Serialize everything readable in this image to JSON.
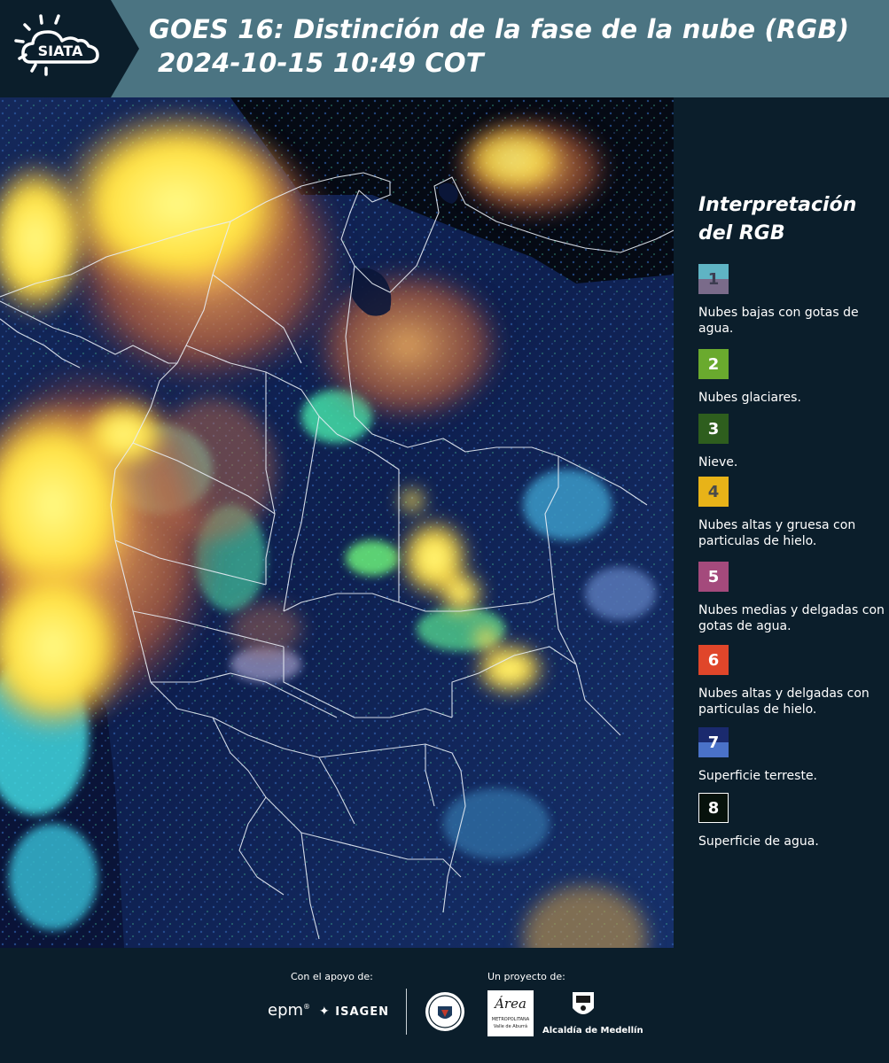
{
  "header": {
    "logo_text": "SIATA",
    "title_line_1": "GOES 16: Distinción de la fase de la nube (RGB)",
    "title_line_2": "2024-10-15 10:49 COT"
  },
  "legend": {
    "title": "Interpretación del RGB",
    "items": [
      {
        "number": "1",
        "label": "Nubes bajas con gotas de agua.",
        "color_top": "#5fb4c4",
        "color_bottom": "#7a6b8a",
        "number_color": "#3c3c50"
      },
      {
        "number": "2",
        "label": "Nubes glaciares.",
        "color_top": "#6aaa2e",
        "color_bottom": "#6aaa2e",
        "number_color": "#ffffff"
      },
      {
        "number": "3",
        "label": "Nieve.",
        "color_top": "#2e5e1e",
        "color_bottom": "#2e5e1e",
        "number_color": "#ffffff"
      },
      {
        "number": "4",
        "label": "Nubes altas y gruesa con particulas de hielo.",
        "color_top": "#e8b318",
        "color_bottom": "#e8b318",
        "number_color": "#4a4a4a"
      },
      {
        "number": "5",
        "label": "Nubes medias y delgadas con gotas de agua.",
        "color_top": "#a44a7c",
        "color_bottom": "#a44a7c",
        "number_color": "#ffffff"
      },
      {
        "number": "6",
        "label": "Nubes altas y delgadas con particulas de hielo.",
        "color_top": "#e0462a",
        "color_bottom": "#e0462a",
        "number_color": "#ffffff"
      },
      {
        "number": "7",
        "label": "Superficie terreste.",
        "color_top": "#1a2a6e",
        "color_bottom": "#4a72c8",
        "number_color": "#ffffff"
      },
      {
        "number": "8",
        "label": "Superficie de agua.",
        "color_top": "#07120c",
        "color_bottom": "#07120c",
        "number_color": "#ffffff"
      }
    ]
  },
  "footer": {
    "support_caption": "Con el apoyo de:",
    "project_caption": "Un proyecto de:",
    "sponsor_epm": "epm",
    "sponsor_isagen": "ISAGEN",
    "partner_area_name": "Área",
    "partner_area_sub": "METROPOLITANA",
    "partner_area_sub2": "Valle de Aburrá",
    "partner_alcaldia": "Alcaldía de Medellín"
  },
  "colors": {
    "background": "#0b1e2b",
    "banner": "#4b7482",
    "map_surface": "#0d1a3e",
    "cloud_high_thick": "#ffee55",
    "cloud_high_thin": "#e07a3a",
    "cloud_ice": "#8aff7a",
    "cloud_low": "#5fd8e8"
  }
}
